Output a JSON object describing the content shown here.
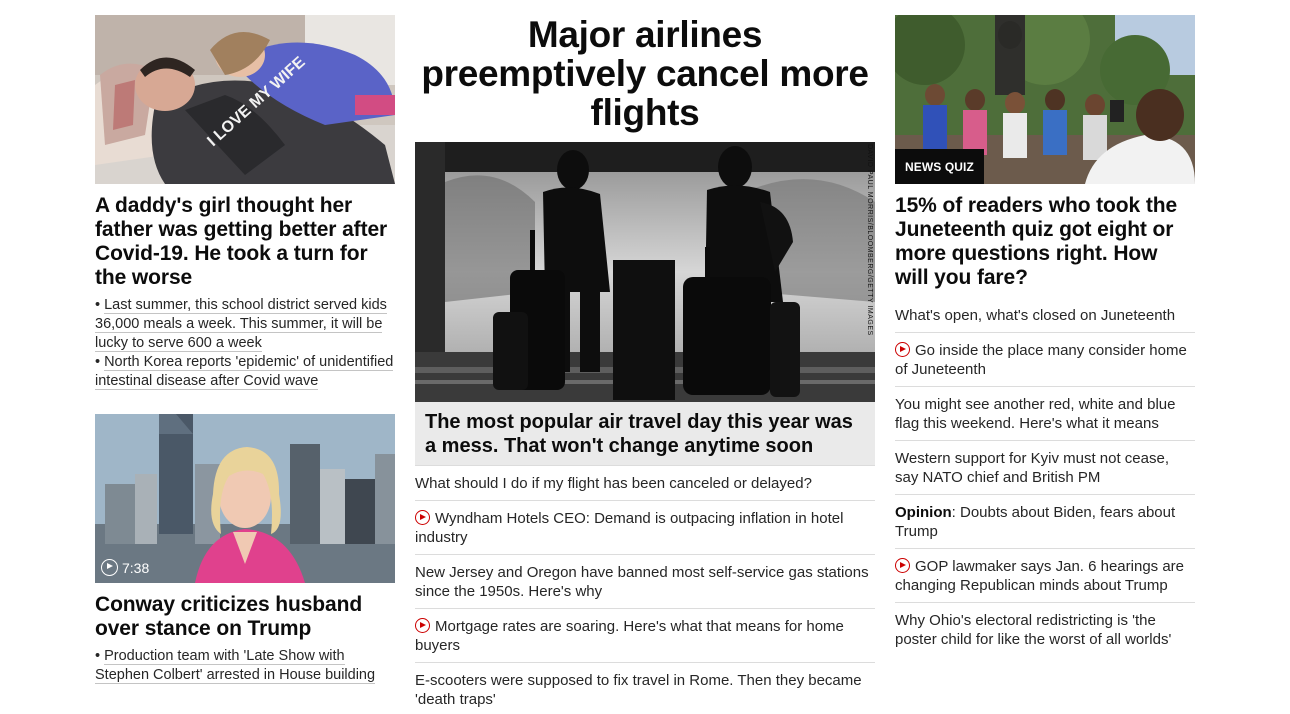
{
  "left": {
    "story1": {
      "image_alt": "Father and daughter lying together",
      "headline": "A daddy's girl thought her father was getting better after Covid-19. He took a turn for the worse",
      "shirt_text": "I LOVE MY WIFE",
      "bullets": [
        "Last summer, this school district served kids 36,000 meals a week. This summer, it will be lucky to serve 600 a week",
        "North Korea reports 'epidemic' of unidentified intestinal disease after Covid wave"
      ]
    },
    "story2": {
      "video_duration": "7:38",
      "headline": "Conway criticizes husband over stance on Trump",
      "bullets": [
        "Production team with 'Late Show with Stephen Colbert' arrested in House building"
      ]
    }
  },
  "center": {
    "main_title": "Major airlines preemptively cancel more flights",
    "photo_credit": "DAVID PAUL MORRIS/BLOOMBERG/GETTY IMAGES",
    "hero_caption": "The most popular air travel day this year was a mess. That won't change anytime soon",
    "links": [
      {
        "text": "What should I do if my flight has been canceled or delayed?",
        "video": false
      },
      {
        "text": "Wyndham Hotels CEO: Demand is outpacing inflation in hotel industry",
        "video": true
      },
      {
        "text": "New Jersey and Oregon have banned most self-service gas stations since the 1950s. Here's why",
        "video": false
      },
      {
        "text": "Mortgage rates are soaring. Here's what that means for home buyers",
        "video": true
      },
      {
        "text": "E-scooters were supposed to fix travel in Rome. Then they became 'death traps'",
        "video": false
      }
    ]
  },
  "right": {
    "badge": "NEWS QUIZ",
    "headline": "15% of readers who took the Juneteenth quiz got eight or more questions right. How will you fare?",
    "links": [
      {
        "text": "What's open, what's closed on Juneteenth",
        "video": false
      },
      {
        "text": "Go inside the place many consider home of Juneteenth",
        "video": true
      },
      {
        "text": "You might see another red, white and blue flag this weekend. Here's what it means",
        "video": false
      },
      {
        "text": "Western support for Kyiv must not cease, say NATO chief and British PM",
        "video": false
      },
      {
        "label": "Opinion",
        "text": ": Doubts about Biden, fears about Trump",
        "video": false
      },
      {
        "text": "GOP lawmaker says Jan. 6 hearings are changing Republican minds about Trump",
        "video": true
      },
      {
        "text": "Why Ohio's electoral redistricting is 'the poster child for like the worst of all worlds'",
        "video": false
      }
    ]
  }
}
